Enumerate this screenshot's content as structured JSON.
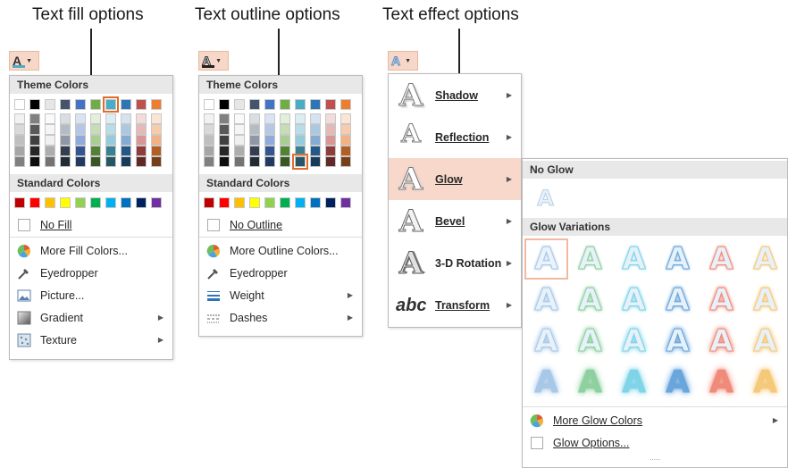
{
  "captions": {
    "fill": "Text fill options",
    "outline": "Text outline options",
    "effect": "Text effect options"
  },
  "fill_menu": {
    "button_glyph": "A",
    "theme_header": "Theme Colors",
    "standard_header": "Standard Colors",
    "no_fill": "No Fill",
    "items": [
      {
        "label": "More Fill Colors...",
        "icon": "palette-icon"
      },
      {
        "label": "Eyedropper",
        "icon": "eyedropper-icon"
      },
      {
        "label": "Picture...",
        "icon": "picture-icon"
      },
      {
        "label": "Gradient",
        "icon": "gradient-icon"
      },
      {
        "label": "Texture",
        "icon": "texture-icon"
      }
    ]
  },
  "outline_menu": {
    "button_glyph": "A",
    "theme_header": "Theme Colors",
    "standard_header": "Standard Colors",
    "no_outline": "No Outline",
    "items": [
      {
        "label": "More Outline Colors...",
        "icon": "palette-icon"
      },
      {
        "label": "Eyedropper",
        "icon": "eyedropper-icon"
      },
      {
        "label": "Weight",
        "icon": "weight-icon"
      },
      {
        "label": "Dashes",
        "icon": "dashes-icon"
      }
    ]
  },
  "effect_menu": {
    "button_glyph": "A",
    "items": [
      {
        "label": "Shadow",
        "icon": "shadow-icon"
      },
      {
        "label": "Reflection",
        "icon": "reflection-icon"
      },
      {
        "label": "Glow",
        "icon": "glow-icon"
      },
      {
        "label": "Bevel",
        "icon": "bevel-icon"
      },
      {
        "label": "3-D Rotation",
        "icon": "3d-rotation-icon"
      },
      {
        "label": "Transform",
        "icon": "transform-icon"
      }
    ],
    "transform_glyph": "abc"
  },
  "glow_submenu": {
    "no_glow_header": "No Glow",
    "variations_header": "Glow Variations",
    "sample_glyph": "A",
    "more_colors": "More Glow Colors",
    "options": "Glow Options...",
    "more_dots": "....."
  },
  "colors": {
    "accent_orange": "#e06d2f",
    "active_bg": "#f9d8cc",
    "theme_top": [
      "#ffffff",
      "#000000",
      "#e7e6e6",
      "#44546a",
      "#4472c4",
      "#70ad47",
      "#4bacc6",
      "#2e75b6",
      "#c0504d",
      "#ed7d31"
    ],
    "standard": [
      "#c00000",
      "#ff0000",
      "#ffc000",
      "#ffff00",
      "#92d050",
      "#00b050",
      "#00b0f0",
      "#0070c0",
      "#002060",
      "#7030a0"
    ],
    "glow_rows": [
      "#a9c8e8",
      "#8fd0a0",
      "#7fd4e8",
      "#6aa6dc",
      "#f08a7a",
      "#f5c97a"
    ]
  }
}
